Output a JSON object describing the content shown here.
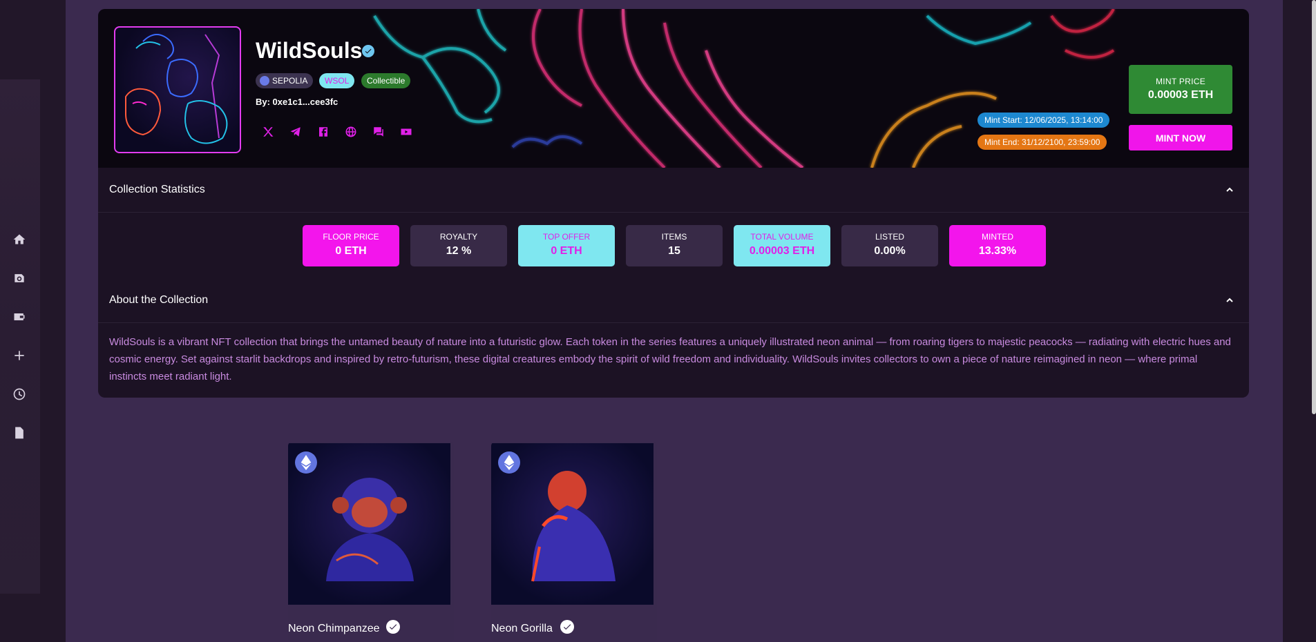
{
  "collection": {
    "title": "WildSouls",
    "network": "SEPOLIA",
    "symbol": "WSOL",
    "category": "Collectible",
    "creator": "By: 0xe1c1...cee3fc",
    "mint_start": "Mint Start: 12/06/2025, 13:14:00",
    "mint_end": "Mint End: 31/12/2100, 23:59:00",
    "mint_price_label": "MINT PRICE",
    "mint_price_value": "0.00003 ETH",
    "mint_button": "MINT NOW"
  },
  "socials": [
    "x-icon",
    "telegram-icon",
    "facebook-icon",
    "globe-icon",
    "chat-icon",
    "youtube-icon"
  ],
  "statistics": {
    "header": "Collection Statistics",
    "items": [
      {
        "label": "FLOOR PRICE",
        "value": "0 ETH",
        "style": "pink"
      },
      {
        "label": "ROYALTY",
        "value": "12 %",
        "style": "dark"
      },
      {
        "label": "TOP OFFER",
        "value": "0 ETH",
        "style": "cyan"
      },
      {
        "label": "ITEMS",
        "value": "15",
        "style": "dark"
      },
      {
        "label": "TOTAL VOLUME",
        "value": "0.00003 ETH",
        "style": "cyan"
      },
      {
        "label": "LISTED",
        "value": "0.00%",
        "style": "dark"
      },
      {
        "label": "MINTED",
        "value": "13.33%",
        "style": "pink"
      }
    ]
  },
  "about": {
    "header": "About the Collection",
    "text": "WildSouls is a vibrant NFT collection that brings the untamed beauty of nature into a futuristic glow. Each token in the series features a uniquely illustrated neon animal — from roaring tigers to majestic peacocks — radiating with electric hues and cosmic energy. Set against starlit backdrops and inspired by retro-futurism, these digital creatures embody the spirit of wild freedom and individuality. WildSouls invites collectors to own a piece of nature reimagined in neon — where primal instincts meet radiant light."
  },
  "nfts": [
    {
      "name": "Neon Chimpanzee"
    },
    {
      "name": "Neon Gorilla"
    }
  ],
  "sidebar": [
    "home-icon",
    "camera-icon",
    "wallet-icon",
    "plus-icon",
    "clock-icon",
    "document-icon"
  ],
  "colors": {
    "accent": "#f315ec",
    "cyan": "#7fe7f0",
    "green": "#2f8a34",
    "background": "#3b2a4f"
  }
}
